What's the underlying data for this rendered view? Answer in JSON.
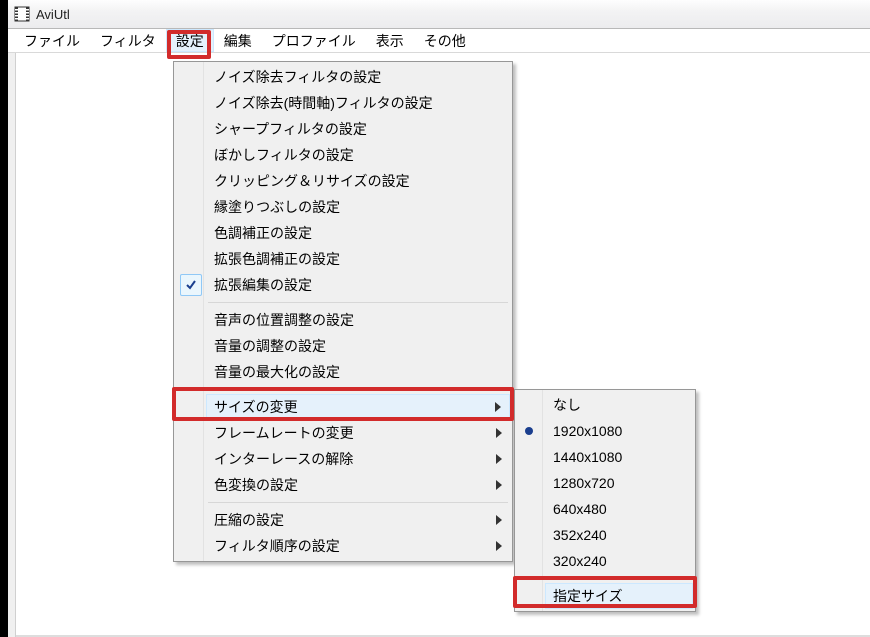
{
  "window": {
    "title": "AviUtl"
  },
  "menubar": {
    "items": [
      {
        "label": "ファイル"
      },
      {
        "label": "フィルタ"
      },
      {
        "label": "設定"
      },
      {
        "label": "編集"
      },
      {
        "label": "プロファイル"
      },
      {
        "label": "表示"
      },
      {
        "label": "その他"
      }
    ]
  },
  "settings_menu": {
    "group0": [
      "ノイズ除去フィルタの設定",
      "ノイズ除去(時間軸)フィルタの設定",
      "シャープフィルタの設定",
      "ぼかしフィルタの設定",
      "クリッピング＆リサイズの設定",
      "縁塗りつぶしの設定",
      "色調補正の設定",
      "拡張色調補正の設定",
      "拡張編集の設定"
    ],
    "group1": [
      "音声の位置調整の設定",
      "音量の調整の設定",
      "音量の最大化の設定"
    ],
    "group2": [
      "サイズの変更",
      "フレームレートの変更",
      "インターレースの解除",
      "色変換の設定"
    ],
    "group3": [
      "圧縮の設定",
      "フィルタ順序の設定"
    ]
  },
  "size_submenu": {
    "items": [
      "なし",
      "1920x1080",
      "1440x1080",
      "1280x720",
      "640x480",
      "352x240",
      "320x240"
    ],
    "specify": "指定サイズ"
  }
}
